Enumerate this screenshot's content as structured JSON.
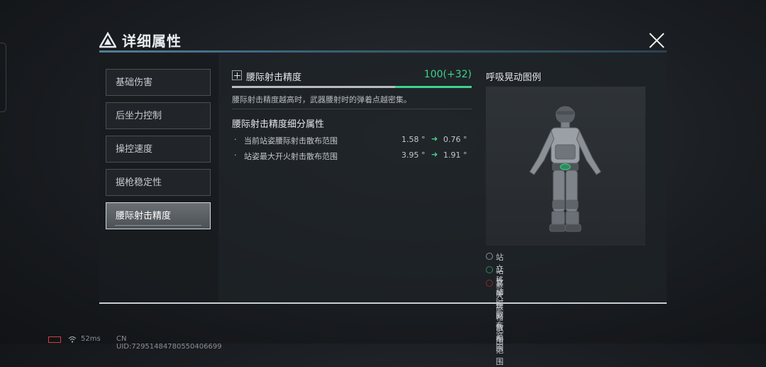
{
  "header": {
    "title": "详细属性",
    "icon": "triangle-emblem-icon",
    "close_icon": "close-icon"
  },
  "nav": {
    "items": [
      {
        "label": "基础伤害",
        "active": false
      },
      {
        "label": "后坐力控制",
        "active": false
      },
      {
        "label": "操控速度",
        "active": false
      },
      {
        "label": "据枪稳定性",
        "active": false
      },
      {
        "label": "腰际射击精度",
        "active": true
      }
    ]
  },
  "stat": {
    "icon": "crosshair-icon",
    "label": "腰际射击精度",
    "value": "100(+32)",
    "base_fraction": 0.68,
    "bonus_fraction": 0.32,
    "description": "腰际射击精度越高时，武器腰射时的弹着点越密集。"
  },
  "sub": {
    "title": "腰际射击精度细分属性",
    "rows": [
      {
        "bullet": "·",
        "name": "当前站姿腰际射击散布范围",
        "old": "1.58 °",
        "arrow": "➜",
        "new": "0.76 °"
      },
      {
        "bullet": "·",
        "name": "站姿最大开火射击散布范围",
        "old": "3.95 °",
        "arrow": "➜",
        "new": "1.91 °"
      }
    ]
  },
  "legend": {
    "title": "呼吸晃动图例",
    "figure_icon": "soldier-figure-icon",
    "items": [
      {
        "label": "站立移动时散布范围",
        "color": "#8a8f94"
      },
      {
        "label": "站立静止时散布范围",
        "color": "#2f8a5e"
      },
      {
        "label": "最大散布范围",
        "color": "#8a2b2b"
      }
    ]
  },
  "footer": {
    "ping": "52ms",
    "uid": "CN UID:72951484780550406699"
  },
  "colors": {
    "accent_green": "#3ed38a",
    "header_line": "#5f8fa8"
  }
}
